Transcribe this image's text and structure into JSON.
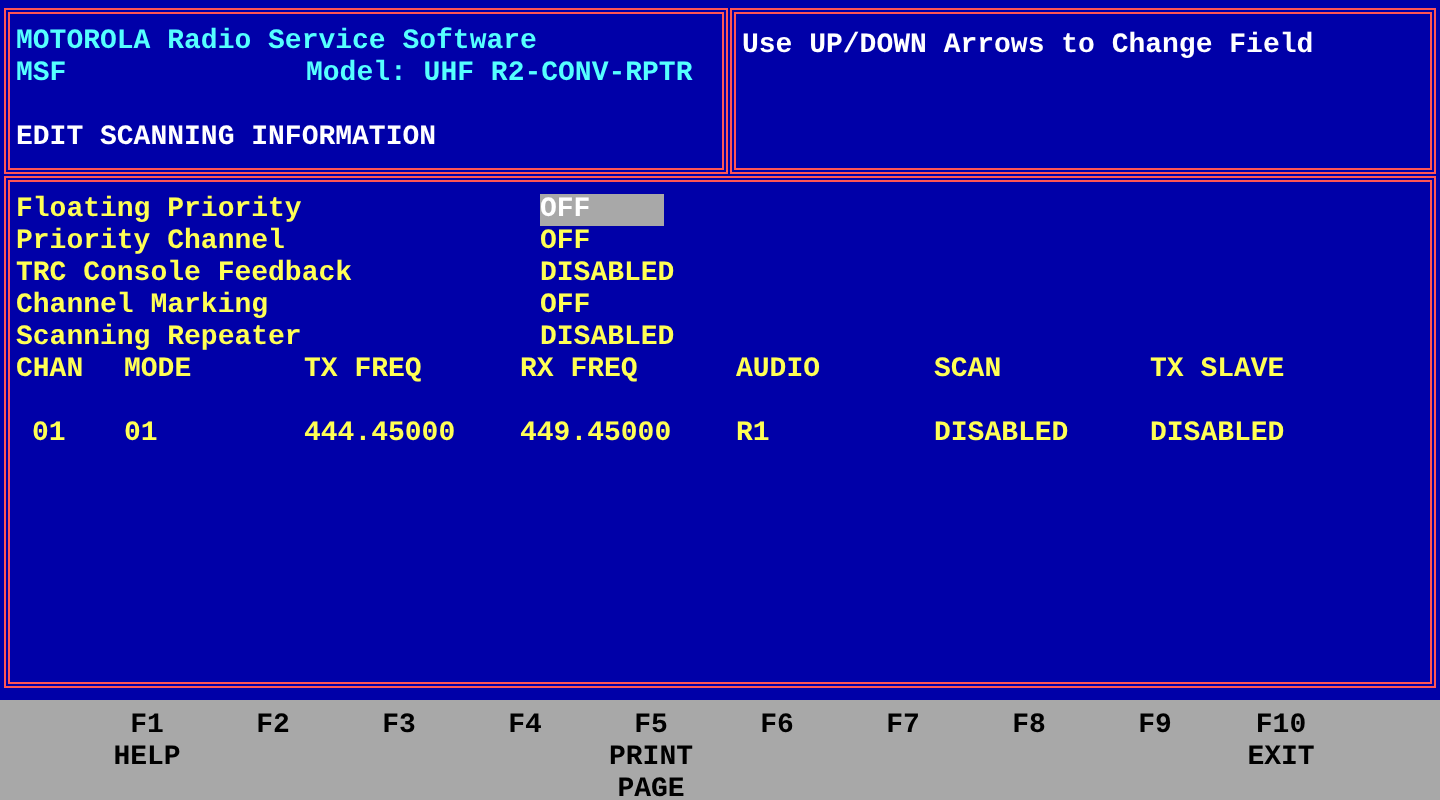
{
  "header": {
    "title": "MOTOROLA Radio Service Software",
    "app": "MSF",
    "model": "Model: UHF R2-CONV-RPTR",
    "screen": "EDIT SCANNING INFORMATION"
  },
  "help": "Use UP/DOWN Arrows to Change Field",
  "fields": [
    {
      "label": "Floating Priority",
      "value": "OFF",
      "selected": true
    },
    {
      "label": "Priority Channel",
      "value": "OFF",
      "selected": false
    },
    {
      "label": "TRC Console Feedback",
      "value": "DISABLED",
      "selected": false
    },
    {
      "label": "Channel Marking",
      "value": "OFF",
      "selected": false
    },
    {
      "label": "Scanning Repeater",
      "value": "DISABLED",
      "selected": false
    }
  ],
  "table": {
    "columns": [
      "CHAN",
      "MODE",
      "TX FREQ",
      "RX FREQ",
      "AUDIO",
      "SCAN",
      "TX SLAVE"
    ],
    "rows": [
      [
        "01",
        "01",
        "444.45000",
        "449.45000",
        "R1",
        "DISABLED",
        "DISABLED"
      ]
    ]
  },
  "function_keys": [
    {
      "key": "F1",
      "action": [
        "HELP"
      ]
    },
    {
      "key": "F2"
    },
    {
      "key": "F3"
    },
    {
      "key": "F4"
    },
    {
      "key": "F5",
      "action": [
        "PRINT",
        "PAGE"
      ]
    },
    {
      "key": "F6"
    },
    {
      "key": "F7"
    },
    {
      "key": "F8"
    },
    {
      "key": "F9"
    },
    {
      "key": "F10",
      "action": [
        "EXIT"
      ]
    }
  ]
}
